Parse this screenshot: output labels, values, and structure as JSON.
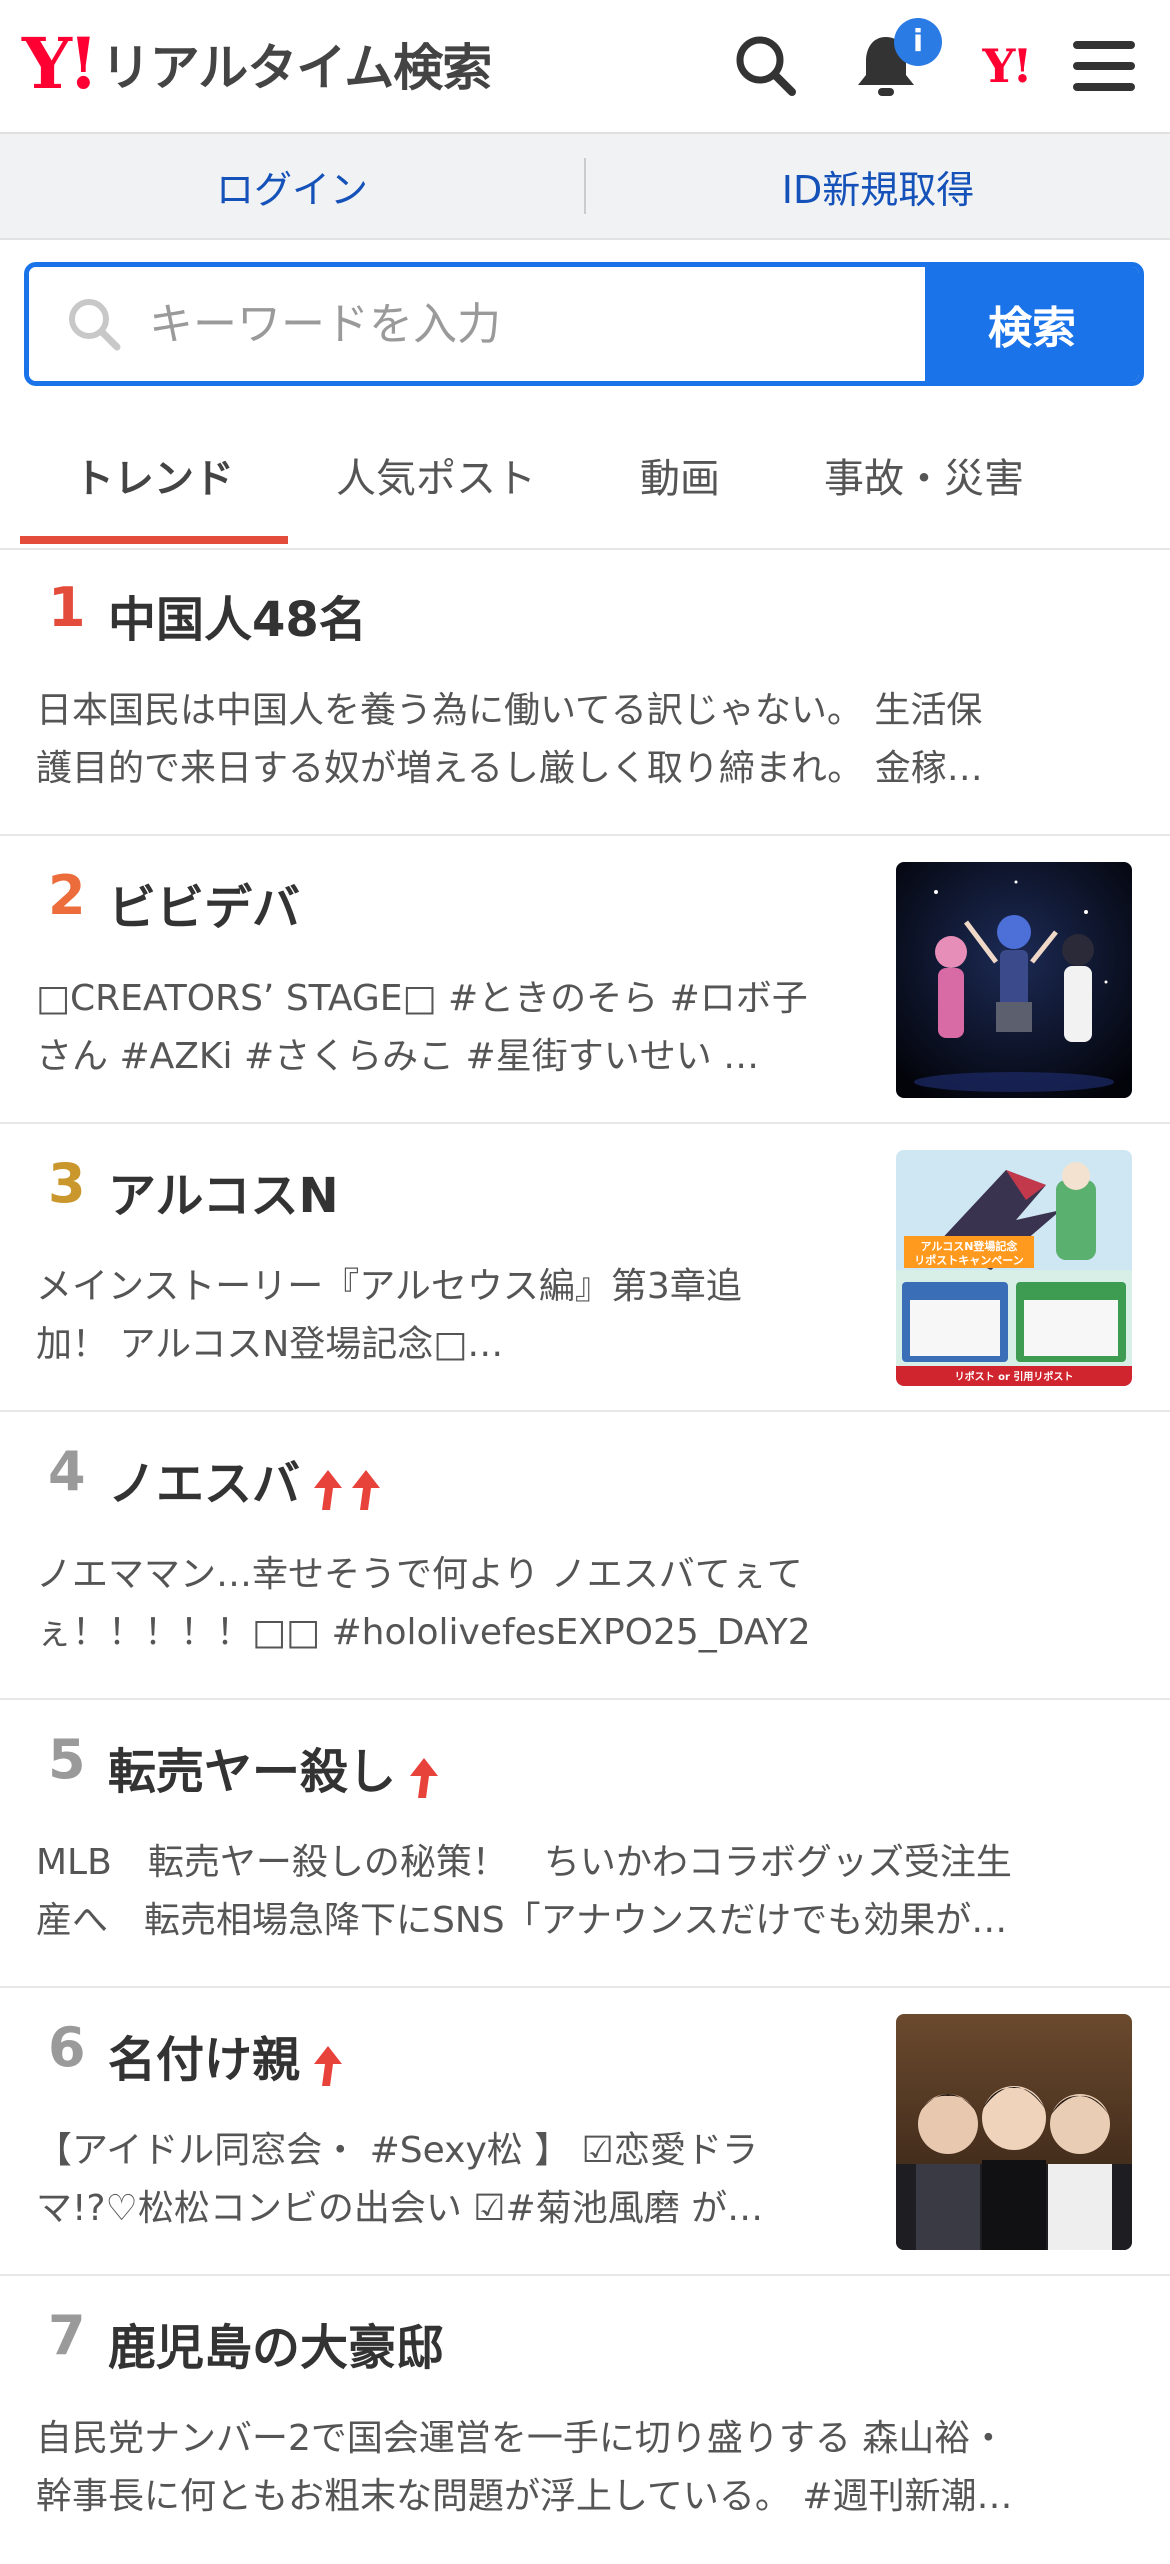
{
  "header": {
    "logo_y": "Y!",
    "logo_text": "リアルタイム検索",
    "notification_badge": "i",
    "yj_icon_text": "Y!"
  },
  "login": {
    "login_label": "ログイン",
    "register_label": "ID新規取得"
  },
  "search": {
    "placeholder": "キーワードを入力",
    "button_label": "検索"
  },
  "tabs": [
    "トレンド",
    "人気ポスト",
    "動画",
    "事故・災害"
  ],
  "colors": {
    "accent_blue": "#1a73e8",
    "brand_red": "#ff0033",
    "rank1": "#e34b3b",
    "rank2": "#ec6c3c",
    "rank3": "#c9972c",
    "rank_default": "#9a9a9a",
    "trend_arrow": "#e8433a"
  },
  "trends": [
    {
      "rank": "1",
      "title": "中国人48名",
      "desc1": "日本国民は中国人を養う為に働いてる訳じゃない。 生活保",
      "desc2": "護目的で来日する奴が増えるし厳しく取り締まれ。 金稼…",
      "arrows": 0,
      "thumb": false
    },
    {
      "rank": "2",
      "title": "ビビデバ",
      "desc1": "□CREATORS’ STAGE□ #ときのそら #ロボ子",
      "desc2": "さん #AZKi #さくらみこ #星街すいせい …",
      "arrows": 0,
      "thumb": true
    },
    {
      "rank": "3",
      "title": "アルコスN",
      "desc1": "メインストーリー『アルセウス編』第3章追",
      "desc2": "加！ アルコスN登場記念□…",
      "arrows": 0,
      "thumb": true
    },
    {
      "rank": "4",
      "title": "ノエスバ",
      "desc1": "ノエママン…幸せそうで何より ノエスバてぇて",
      "desc2": "ぇ！！！！！□□ #hololivefesEXPO25_DAY2",
      "arrows": 2,
      "thumb": false
    },
    {
      "rank": "5",
      "title": "転売ヤー殺し",
      "desc1": "MLB　転売ヤー殺しの秘策！　ちいかわコラボグッズ受注生",
      "desc2": "産へ　転売相場急降下にSNS「アナウンスだけでも効果が…",
      "arrows": 1,
      "thumb": false
    },
    {
      "rank": "6",
      "title": "名付け親",
      "desc1": "【アイドル同窓会・ #Sexy松 】 ☑恋愛ドラ",
      "desc2": "マ!?♡松松コンビの出会い ☑#菊池風磨 が…",
      "arrows": 1,
      "thumb": true
    },
    {
      "rank": "7",
      "title": "鹿児島の大豪邸",
      "desc1": "自民党ナンバー2で国会運営を一手に切り盛りする 森山裕・",
      "desc2": "幹事長に何ともお粗末な問題が浮上している。 #週刊新潮…",
      "arrows": 0,
      "thumb": false
    }
  ],
  "thumb2_text": "",
  "thumb3_text_top": "アルコスN登場記念",
  "thumb3_text_sub": "リポストキャンペーン",
  "thumb3_footer": "リポスト or 引用リポスト"
}
